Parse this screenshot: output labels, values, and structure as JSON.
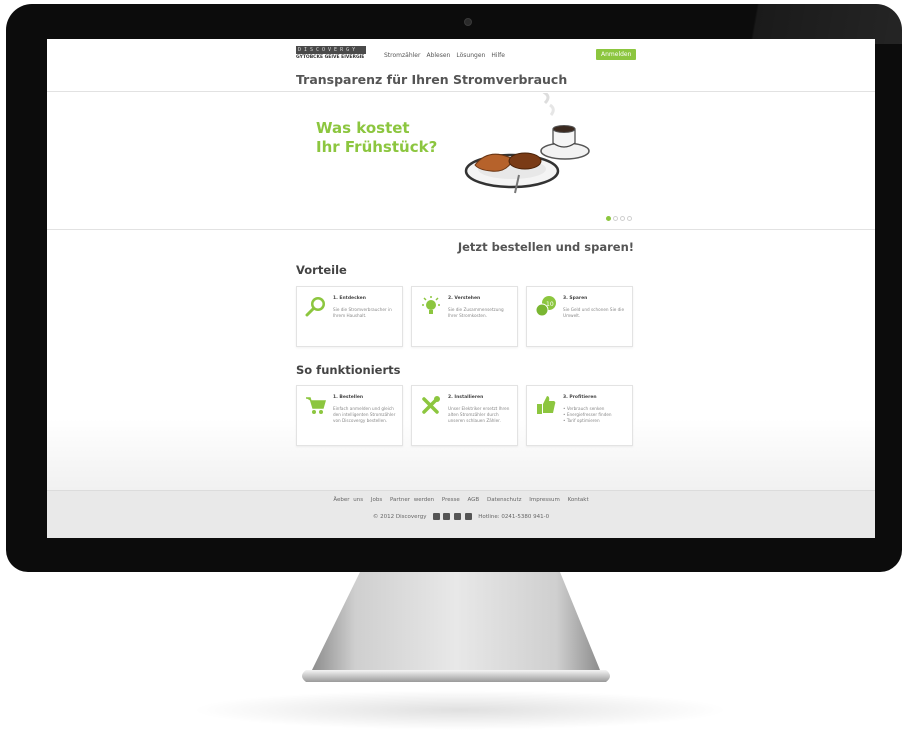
{
  "nav": {
    "logo_top": "DISCOVERGY",
    "logo_bottom": "GYTOBCKE GEIVE EIVERGIE",
    "links": [
      "Stromzähler",
      "Ablesen",
      "Lösungen",
      "Hilfe"
    ],
    "login": "Anmelden"
  },
  "page_title": "Transparenz für Ihren Stromverbrauch",
  "hero": {
    "line1": "Was kostet",
    "line2": "Ihr Frühstück?",
    "slides": 4,
    "active_slide": 1
  },
  "cta": "Jetzt bestellen und sparen!",
  "vorteile": {
    "heading": "Vorteile",
    "cards": [
      {
        "icon": "magnifier-plug-icon",
        "title": "1. Entdecken",
        "text": "Sie die Stromverbraucher in Ihrem Haushalt."
      },
      {
        "icon": "lightbulb-icon",
        "title": "2. Verstehen",
        "text": "Sie die Zusammensetzung Ihrer Stromkosten."
      },
      {
        "icon": "coins-icon",
        "title": "3. Sparen",
        "text": "Sie Geld und schonen Sie die Umwelt."
      }
    ]
  },
  "funktion": {
    "heading": "So funktionierts",
    "cards": [
      {
        "icon": "cart-icon",
        "title": "1. Bestellen",
        "text": "Einfach anmelden und gleich den intelligenten Stromzähler von Discovergy bestellen."
      },
      {
        "icon": "tools-icon",
        "title": "2. Installieren",
        "text": "Unser Elektriker ersetzt Ihren alten Stromzähler durch unseren schlauen Zähler."
      },
      {
        "icon": "thumbs-up-icon",
        "title": "3. Profitieren",
        "bullets": [
          "Verbrauch senken",
          "Energiefresser finden",
          "Tarif optimieren"
        ]
      }
    ]
  },
  "footer": {
    "links": [
      "Äeber uns",
      "Jobs",
      "Partner werden",
      "Presse",
      "AGB",
      "Datenschutz",
      "Impressum",
      "Kontakt"
    ],
    "copyright": "© 2012 Discovergy",
    "hotline": "Hotline: 0241-5380 941-0"
  },
  "colors": {
    "accent": "#8cc63f",
    "bezel": "#0c0c0c"
  }
}
